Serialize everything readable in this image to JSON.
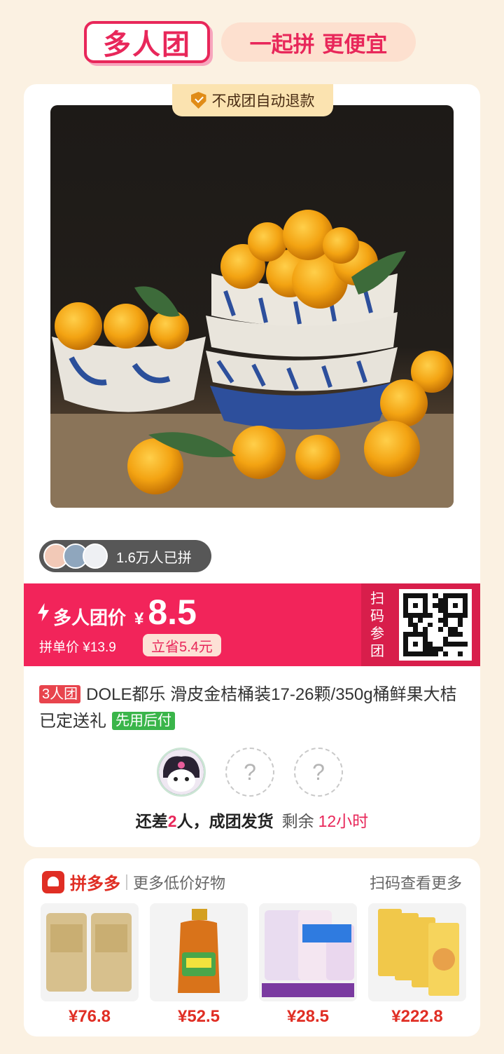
{
  "header": {
    "logo_text": "多人团",
    "slogan": "一起拼 更便宜"
  },
  "product": {
    "refund_badge": "不成团自动退款",
    "joined_count": "1.6万人已拼",
    "group_price_label": "多人团价",
    "currency_symbol": "¥",
    "group_price": "8.5",
    "single_price": "拼单价 ¥13.9",
    "save_amount": "立省5.4元",
    "scan_label": "扫码参团",
    "team_tag": "3人团",
    "title": "DOLE都乐 滑皮金桔桶装17-26颗/350g桶鲜果大桔已定送礼",
    "pay_later_tag": "先用后付"
  },
  "group_status": {
    "member_placeholder": "?",
    "prefix": "还差",
    "missing": "2",
    "suffix": "人，成团发货",
    "remaining_label": "剩余",
    "remaining_time": "12小时"
  },
  "recommend": {
    "brand": "拼多多",
    "subtitle": "更多低价好物",
    "more": "扫码查看更多",
    "items": [
      {
        "price": "¥76.8"
      },
      {
        "price": "¥52.5"
      },
      {
        "price": "¥28.5"
      },
      {
        "price": "¥222.8"
      }
    ]
  },
  "colors": {
    "accent": "#f2245a",
    "pdd_red": "#e02e24",
    "page_bg": "#fbf1e2"
  }
}
